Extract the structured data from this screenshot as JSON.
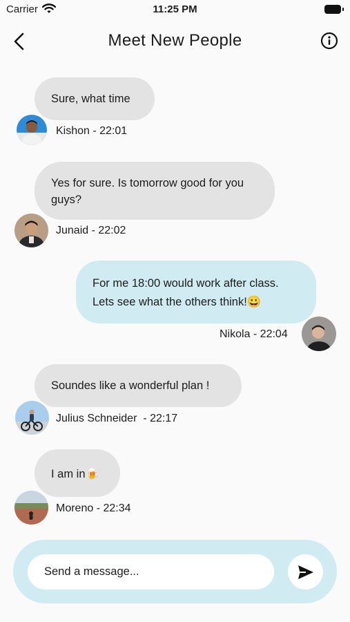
{
  "status_bar": {
    "carrier": "Carrier",
    "time": "11:25 PM"
  },
  "header": {
    "title": "Meet New People",
    "back_icon": "chevron-left-icon",
    "info_icon": "info-circle-icon"
  },
  "messages": [
    {
      "text": "Sure, what time",
      "meta": "Kishon - 22:01",
      "direction": "incoming"
    },
    {
      "text": "Yes for sure. Is tomorrow good for you guys?",
      "meta": "Junaid - 22:02",
      "direction": "incoming"
    },
    {
      "text": "For me 18:00 would work after class.",
      "text2": "Lets see what the others think!😀",
      "meta": "Nikola - 22:04",
      "direction": "outgoing"
    },
    {
      "text": "Soundes like a wonderful plan !",
      "meta": "Julius Schneider  - 22:17",
      "direction": "incoming"
    },
    {
      "text": "I am in🍺",
      "meta": "Moreno - 22:34",
      "direction": "incoming"
    }
  ],
  "composer": {
    "placeholder": "Send a message...",
    "value": "",
    "send_icon": "send-icon"
  },
  "colors": {
    "incoming_bubble": "#e3e3e3",
    "outgoing_bubble": "#d0ebf2",
    "background": "#fafafa"
  }
}
